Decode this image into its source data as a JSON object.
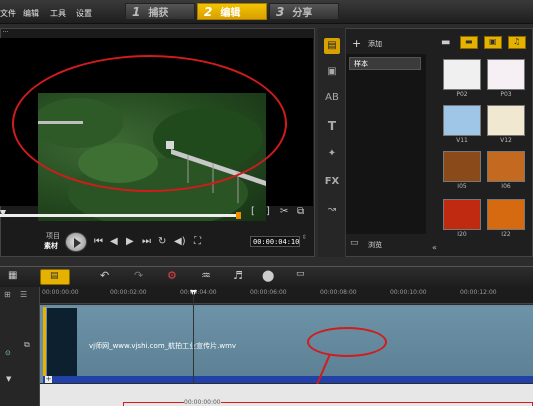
{
  "menubar": {
    "items": [
      "文件",
      "编辑",
      "工具",
      "设置"
    ],
    "steps": [
      {
        "num": "1",
        "label": "捕获",
        "active": false
      },
      {
        "num": "2",
        "label": "编辑",
        "active": true
      },
      {
        "num": "3",
        "label": "分享",
        "active": false
      }
    ]
  },
  "player": {
    "mode_project": "项目",
    "mode_clip": "素材",
    "timecode": "00:00:04:10",
    "bracket_in": "[",
    "bracket_out": "]"
  },
  "library": {
    "add_label": "添加",
    "folder": "样本",
    "browse_label": "浏览",
    "side_fx": "FX",
    "thumbnails": [
      {
        "label": "P02",
        "color": "#f0f0f0"
      },
      {
        "label": "P03",
        "color": "#f6f0f4"
      },
      {
        "label": "V11",
        "color": "#9fc6e6"
      },
      {
        "label": "V12",
        "color": "#f0e8d0"
      },
      {
        "label": "I05",
        "color": "#8a4a1a"
      },
      {
        "label": "I06",
        "color": "#c46a20"
      },
      {
        "label": "I20",
        "color": "#c02a10"
      },
      {
        "label": "I22",
        "color": "#d66a10"
      }
    ]
  },
  "timeline": {
    "ruler_ticks": [
      "00:00:00:00",
      "00:00:02:00",
      "00:00:04:00",
      "00:00:06:00",
      "00:00:08:00",
      "00:00:10:00",
      "00:00:12:00"
    ],
    "clip_name": "vj师网_www.vjshi.com_航拍工业宣传片.wmv",
    "lower_timecode": "00:00:00:00"
  },
  "colors": {
    "accent": "#f0b800",
    "annotation": "#d21b1b"
  }
}
